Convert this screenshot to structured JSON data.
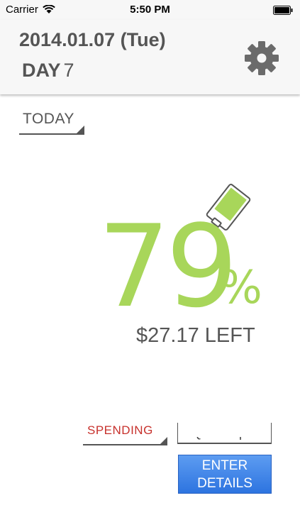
{
  "status_bar": {
    "carrier": "Carrier",
    "time": "5:50 PM"
  },
  "header": {
    "date": "2014.01.07 (Tue)",
    "day_label": "DAY",
    "day_number": "7",
    "settings_icon": "gear-icon"
  },
  "period_selector": {
    "label": "TODAY"
  },
  "budget": {
    "percent_value": "79",
    "percent_sign": "%",
    "amount_left": "$27.17 LEFT",
    "battery_level": 0.79,
    "accent_color": "#a8d65a"
  },
  "entry": {
    "category_label": "SPENDING",
    "category_color": "#c7312c",
    "quick_input_placeholder": "Quick Input",
    "enter_details_label_line1": "ENTER",
    "enter_details_label_line2": "DETAILS",
    "button_color": "#2d74e0"
  }
}
